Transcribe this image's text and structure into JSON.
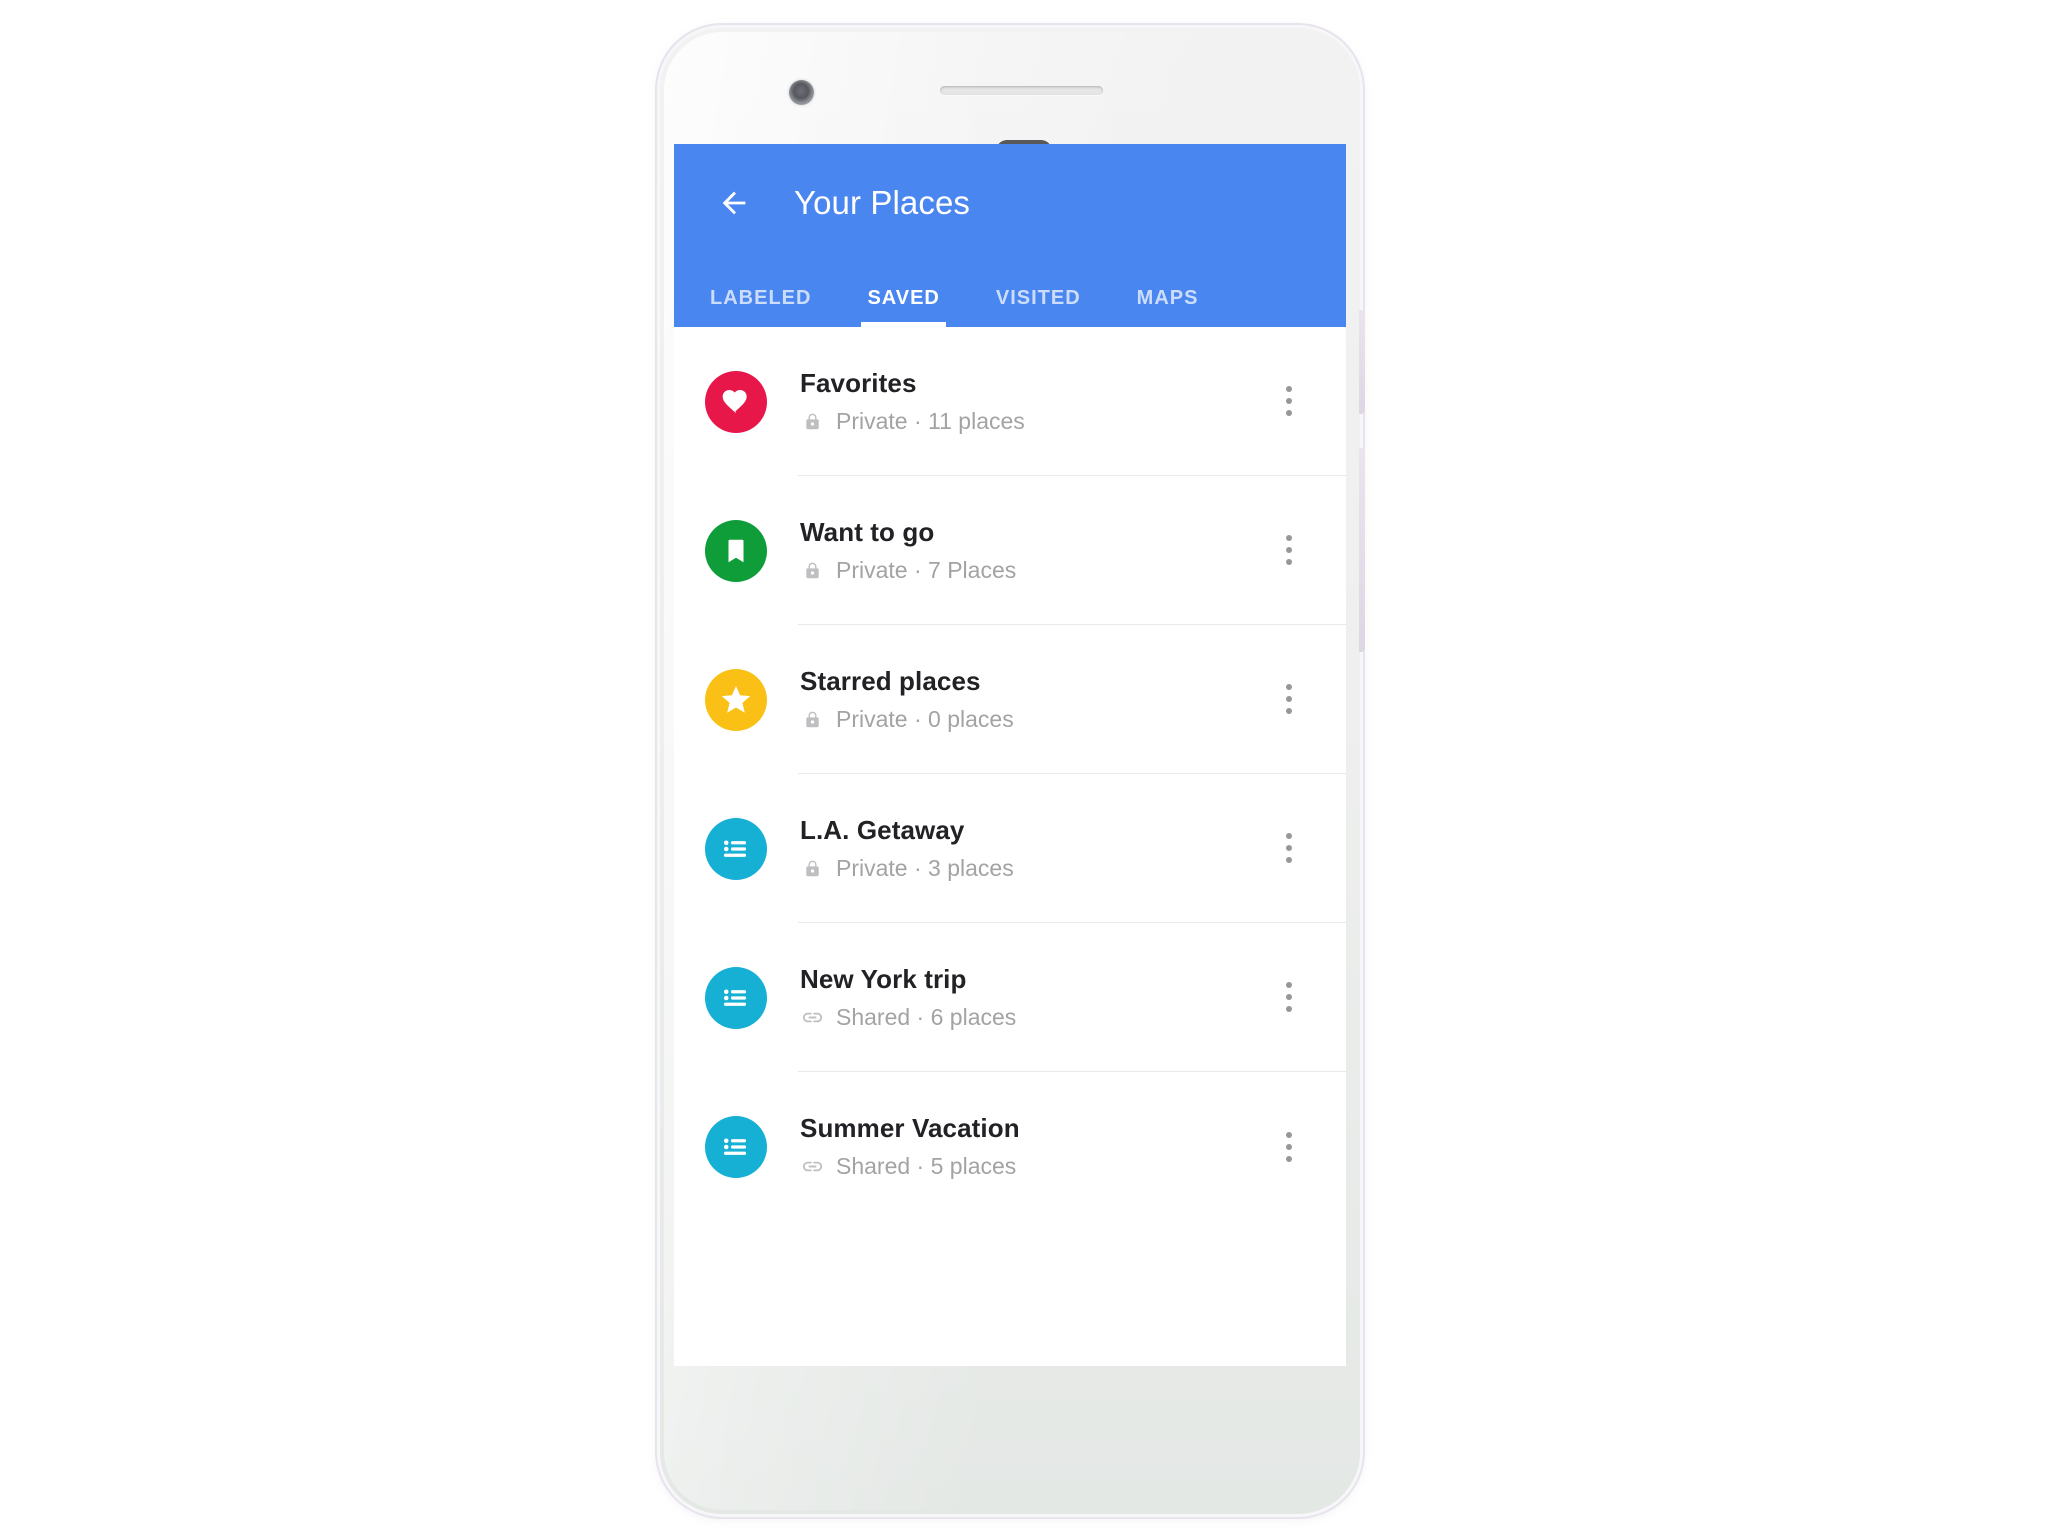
{
  "device": {
    "name": "android-phone-mockup",
    "camera_icon": "front-camera",
    "speaker_icon": "earpiece-speaker-grille",
    "sensor_icon": "proximity-sensor",
    "power_button": "power-button",
    "volume_button": "volume-rocker"
  },
  "colors": {
    "app_bar_blue": "#4a86f0",
    "favorites_pink": "#e8174a",
    "want_to_go_green": "#0f9d3a",
    "starred_yellow": "#fbc016",
    "list_cyan": "#16b0d4",
    "title_text": "#222226",
    "subtitle_text": "#a3a3a6",
    "divider": "#e9e9e9"
  },
  "app_bar": {
    "back_icon": "arrow-left-icon",
    "title": "Your Places"
  },
  "tabs": [
    {
      "label": "LABELED",
      "active": false
    },
    {
      "label": "SAVED",
      "active": true
    },
    {
      "label": "VISITED",
      "active": false
    },
    {
      "label": "MAPS",
      "active": false
    }
  ],
  "list": {
    "overflow_icon": "more-vertical-icon",
    "items": [
      {
        "title": "Favorites",
        "visibility": "Private",
        "separator": "·",
        "count": "11 places",
        "subtitle": "Private · 11 places",
        "badge_icon": "heart-icon",
        "badge_color": "#e8174a",
        "status_icon": "lock-icon"
      },
      {
        "title": "Want to go",
        "visibility": "Private",
        "separator": "·",
        "count": "7 Places",
        "subtitle": "Private · 7 Places",
        "badge_icon": "bookmark-icon",
        "badge_color": "#0f9d3a",
        "status_icon": "lock-icon"
      },
      {
        "title": "Starred places",
        "visibility": "Private",
        "separator": "·",
        "count": "0 places",
        "subtitle": "Private · 0 places",
        "badge_icon": "star-icon",
        "badge_color": "#fbc016",
        "status_icon": "lock-icon"
      },
      {
        "title": "L.A. Getaway",
        "visibility": "Private",
        "separator": "·",
        "count": "3 places",
        "subtitle": "Private · 3 places",
        "badge_icon": "list-icon",
        "badge_color": "#16b0d4",
        "status_icon": "lock-icon"
      },
      {
        "title": "New York trip",
        "visibility": "Shared",
        "separator": "·",
        "count": "6 places",
        "subtitle": "Shared · 6 places",
        "badge_icon": "list-icon",
        "badge_color": "#16b0d4",
        "status_icon": "link-icon"
      },
      {
        "title": "Summer Vacation",
        "visibility": "Shared",
        "separator": "·",
        "count": "5 places",
        "subtitle": "Shared · 5 places",
        "badge_icon": "list-icon",
        "badge_color": "#16b0d4",
        "status_icon": "link-icon"
      }
    ]
  }
}
